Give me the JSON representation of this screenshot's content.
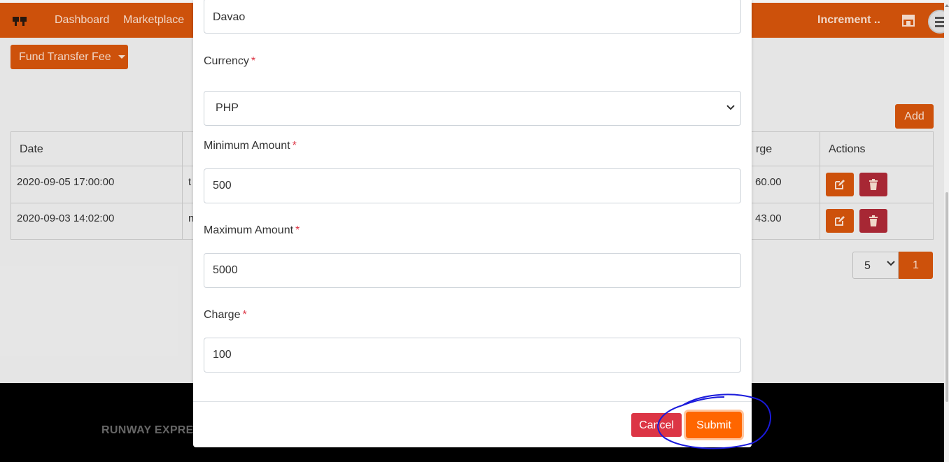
{
  "navbar": {
    "links": [
      "Dashboard",
      "Marketplace"
    ],
    "user": "Increment .."
  },
  "toolbar": {
    "dropdown_label": "Fund Transfer Fee",
    "add_label": "Add"
  },
  "table": {
    "headers": [
      "Date",
      "",
      "rge",
      "Actions"
    ],
    "rows": [
      {
        "date": "2020-09-05 17:00:00",
        "col2": "t",
        "charge": "60.00"
      },
      {
        "date": "2020-09-03 14:02:00",
        "col2": "n",
        "charge": "43.00"
      }
    ]
  },
  "pagination": {
    "page_size": "5",
    "current_page": "1"
  },
  "footer": {
    "brand": "RUNWAY EXPRES"
  },
  "modal": {
    "city_value": "Davao",
    "currency_label": "Currency",
    "currency_value": "PHP",
    "min_label": "Minimum Amount",
    "min_value": "500",
    "max_label": "Maximum Amount",
    "max_value": "5000",
    "charge_label": "Charge",
    "charge_value": "100",
    "required_mark": "*",
    "cancel_label": "Cancel",
    "submit_label": "Submit"
  },
  "colors": {
    "brand": "#d9560c",
    "submit": "#ff6600",
    "danger": "#dc3545",
    "annotation": "#1a1adb"
  }
}
